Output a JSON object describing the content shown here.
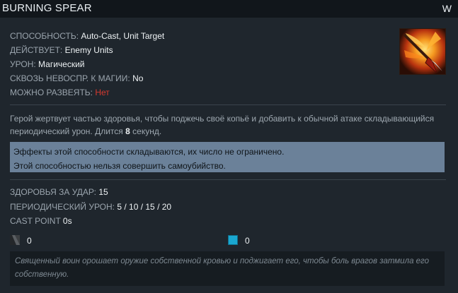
{
  "header": {
    "title": "BURNING SPEAR",
    "hotkey": "W"
  },
  "attributes": [
    {
      "key": "СПОСОБНОСТЬ: ",
      "value": "Auto-Cast, Unit Target",
      "color": "#eef2f4"
    },
    {
      "key": "ДЕЙСТВУЕТ: ",
      "value": "Enemy Units",
      "color": "#eef2f4"
    },
    {
      "key": "УРОН: ",
      "value": "Магический",
      "color": "#eef2f4"
    },
    {
      "key": "СКВОЗЬ НЕВОСПР. К МАГИИ: ",
      "value": "No",
      "color": "#eef2f4"
    },
    {
      "key": "МОЖНО РАЗВЕЯТЬ: ",
      "value": "Нет",
      "color": "#d63a2f"
    }
  ],
  "ability_icon": "burning-spear-icon",
  "description": {
    "part1": "Герой жертвует частью здоровья, чтобы поджечь своё копьё и добавить к обычной атаке складывающийся периодический урон. Длится ",
    "duration": "8",
    "part2": " секунд."
  },
  "notes": [
    "Эффекты этой способности складываются, их число не ограничено.",
    "Этой способностью нельзя совершить самоубийство."
  ],
  "stats": [
    {
      "key": "ЗДОРОВЬЯ ЗА УДАР: ",
      "value": "15"
    },
    {
      "key": "ПЕРИОДИЧЕСКИЙ УРОН: ",
      "value": "5 / 10 / 15 / 20"
    },
    {
      "key": "CAST POINT ",
      "value": "0s"
    }
  ],
  "costs": {
    "cooldown": {
      "icon": "cooldown-icon",
      "value": "0",
      "color": "#3c3f42"
    },
    "mana": {
      "icon": "mana-icon",
      "value": "0",
      "color": "#1aa7d0"
    }
  },
  "lore": "Священный воин орошает оружие собственной кровью и поджигает его, чтобы боль врагов затмила его собственную."
}
